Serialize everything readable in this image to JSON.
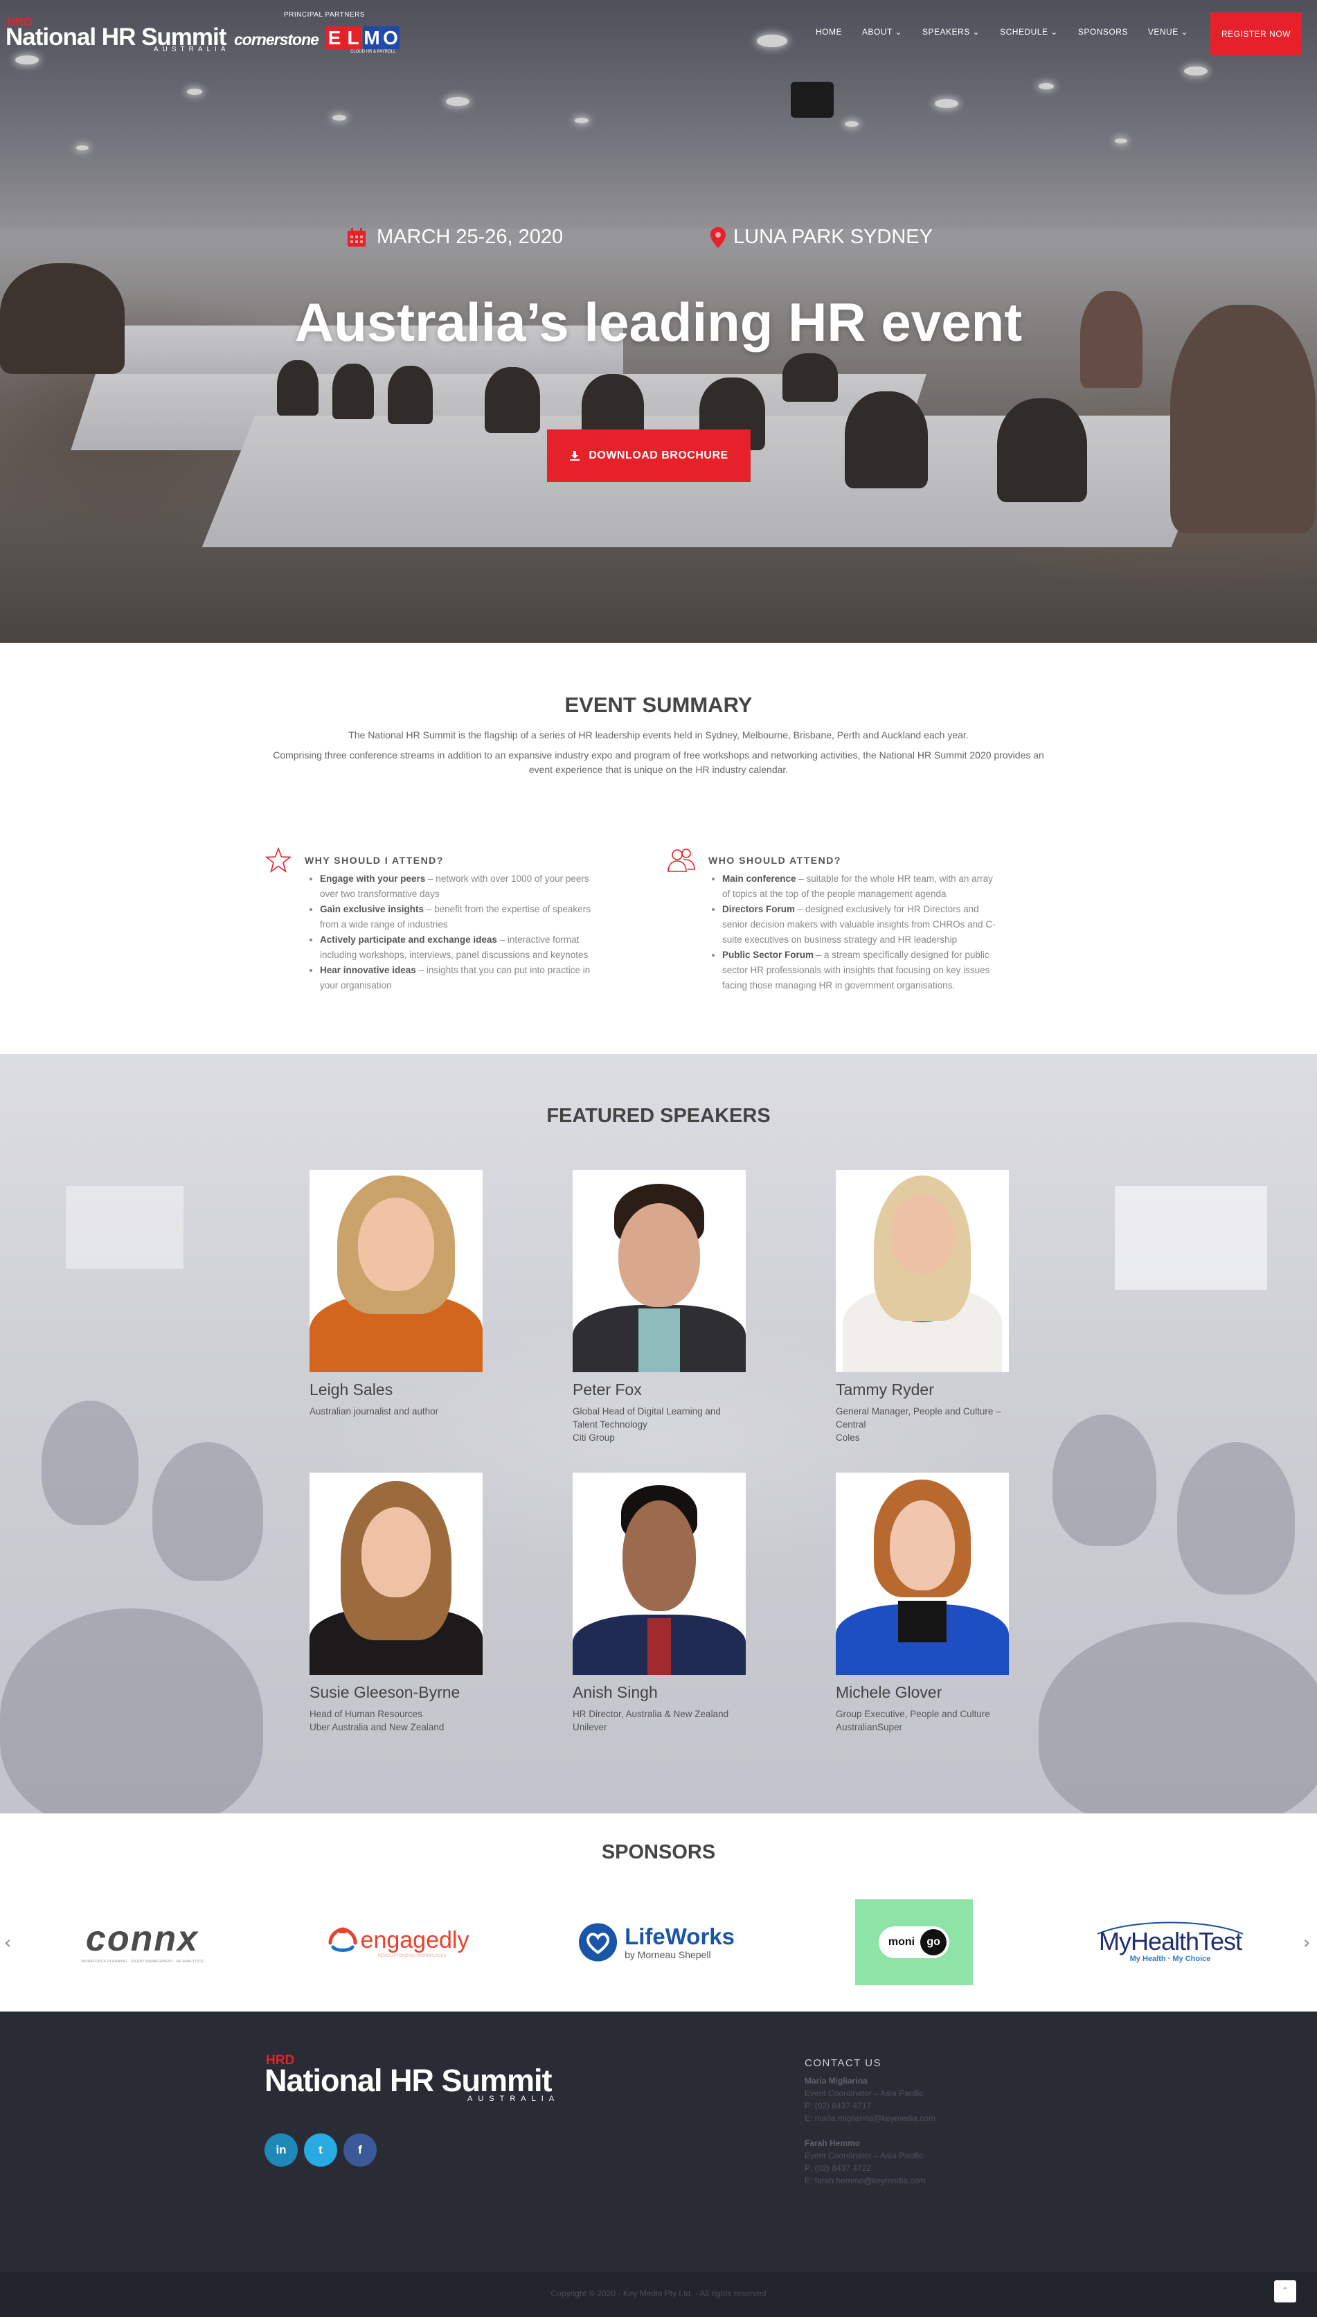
{
  "header": {
    "logo_hrd": "HRD",
    "logo_main": "National HR Summit",
    "logo_sub": "AUSTRALIA",
    "partners_label": "PRINCIPAL PARTNERS",
    "partner1": "cornerstone",
    "partner2_letters": [
      "E",
      "L",
      "M",
      "O"
    ],
    "partner2_tagline": "CLOUD HR & PAYROLL",
    "nav": [
      "HOME",
      "ABOUT ⌄",
      "SPEAKERS ⌄",
      "SCHEDULE ⌄",
      "SPONSORS",
      "VENUE ⌄"
    ],
    "register": "REGISTER NOW"
  },
  "hero": {
    "date": "MARCH 25-26, 2020",
    "location": "LUNA PARK SYDNEY",
    "title": "Australia’s leading HR event",
    "button": "DOWNLOAD BROCHURE",
    "icons": {
      "date": "calendar-icon",
      "location": "map-pin-icon",
      "button": "download-icon"
    }
  },
  "summary": {
    "title": "EVENT SUMMARY",
    "p1": "The National HR Summit is the flagship of a series of HR leadership events held in Sydney, Melbourne, Brisbane, Perth and Auckland each year.",
    "p2": "Comprising three conference streams in addition to an expansive industry expo and program of free workshops and networking activities, the National HR Summit 2020 provides an event experience that is unique on the HR industry calendar.",
    "why": {
      "title": "WHY SHOULD I ATTEND?",
      "items": [
        {
          "b": "Engage with your peers",
          "t": " – network with over 1000 of your peers over two transformative days"
        },
        {
          "b": "Gain exclusive insights",
          "t": " – benefit from the expertise of speakers from a wide range of industries"
        },
        {
          "b": "Actively participate and exchange ideas",
          "t": " – interactive format including workshops, interviews, panel discussions and keynotes"
        },
        {
          "b": "Hear innovative ideas",
          "t": " – insights that you can put into practice in your organisation"
        }
      ]
    },
    "who": {
      "title": "WHO SHOULD ATTEND?",
      "items": [
        {
          "b": "Main conference",
          "t": " – suitable for the whole HR team, with an array of topics at the top of the people management agenda"
        },
        {
          "b": "Directors Forum",
          "t": " – designed exclusively for HR Directors and senior decision makers with valuable insights from CHROs and C-suite executives on business strategy and HR leadership"
        },
        {
          "b": "Public Sector Forum",
          "t": " – a stream specifically designed for public sector HR professionals with insights that focusing on key issues facing those managing HR in government organisations."
        }
      ]
    }
  },
  "speakers": {
    "title": "FEATURED SPEAKERS",
    "items": [
      {
        "name": "Leigh Sales",
        "role": [
          "Australian journalist and author"
        ]
      },
      {
        "name": "Peter Fox",
        "role": [
          "Global Head of Digital Learning and Talent Technology",
          "Citi Group"
        ]
      },
      {
        "name": "Tammy Ryder",
        "role": [
          "General Manager, People and Culture – Central",
          "Coles"
        ]
      },
      {
        "name": "Susie Gleeson-Byrne",
        "role": [
          "Head of Human Resources",
          "Uber Australia and New Zealand"
        ]
      },
      {
        "name": "Anish Singh",
        "role": [
          "HR Director, Australia & New Zealand",
          "Unilever"
        ]
      },
      {
        "name": "Michele Glover",
        "role": [
          "Group Executive, People and Culture",
          "AustralianSuper"
        ]
      }
    ]
  },
  "sponsors": {
    "title": "SPONSORS",
    "prev": "‹",
    "next": "›",
    "connx": "connx",
    "connx_tag": "WORKFORCE PLANNING · TALENT MANAGEMENT · HR ANALYTICS",
    "engagedly": "engagedly",
    "engagedly_tag": "REVOLUTIONIZING WORKPLACES",
    "lifeworks": "LifeWorks",
    "lifeworks_sub": "by Morneau Shepell",
    "monigo_a": "moni",
    "monigo_b": "go",
    "myhealth": "MyHealthTest",
    "myhealth_tag": "My Health · My Choice"
  },
  "footer": {
    "logo_hrd": "HRD",
    "logo_main": "National HR Summit",
    "logo_sub": "AUSTRALIA",
    "social": [
      "in",
      "t",
      "f"
    ],
    "contact_title": "CONTACT US",
    "contacts": [
      {
        "name": "Maria Migliarina",
        "role": "Event Coordinator – Asia Pacific",
        "phone": "P: (02) 8437 4717",
        "email": "E: maria.migliarina@keymedia.com"
      },
      {
        "name": "Farah Hemmo",
        "role": "Event Coordinator – Asia Pacific",
        "phone": "P: (02) 8437 4722",
        "email": "E: farah.hemmo@keymedia.com"
      }
    ],
    "copyright": "Copyright © 2020 - Key Media Pty Ltd. - All rights reserved",
    "to_top": "⌃"
  },
  "colors": {
    "accent": "#e62129",
    "footer": "#2a2c35",
    "linkedin": "#1e88b6",
    "twitter": "#2aaae2",
    "facebook": "#3b5998"
  }
}
